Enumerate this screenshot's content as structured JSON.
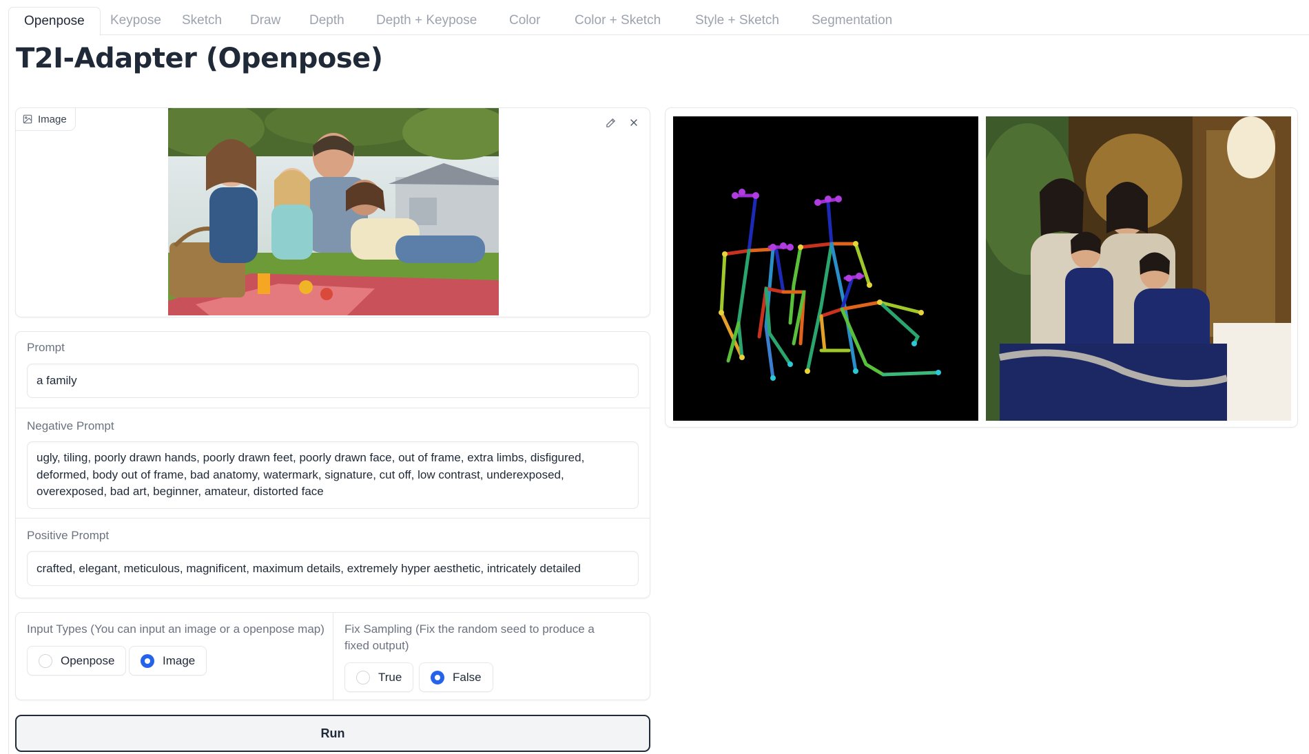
{
  "tabs": [
    {
      "label": "Openpose",
      "active": true
    },
    {
      "label": "Keypose"
    },
    {
      "label": "Sketch"
    },
    {
      "label": "Draw"
    },
    {
      "label": "Depth"
    },
    {
      "label": "Depth + Keypose"
    },
    {
      "label": "Color"
    },
    {
      "label": "Color + Sketch"
    },
    {
      "label": "Style + Sketch"
    },
    {
      "label": "Segmentation"
    }
  ],
  "title": "T2I-Adapter (Openpose)",
  "image_input": {
    "label": "Image",
    "icon": "image-icon",
    "tools": [
      "edit-icon",
      "close-icon"
    ]
  },
  "prompt": {
    "label": "Prompt",
    "value": "a family"
  },
  "negative_prompt": {
    "label": "Negative Prompt",
    "value": "ugly, tiling, poorly drawn hands, poorly drawn feet, poorly drawn face, out of frame, extra limbs, disfigured, deformed, body out of frame, bad anatomy, watermark, signature, cut off, low contrast, underexposed, overexposed, bad art, beginner, amateur, distorted face"
  },
  "positive_prompt": {
    "label": "Positive Prompt",
    "value": "crafted, elegant, meticulous, magnificent, maximum details, extremely hyper aesthetic, intricately detailed"
  },
  "input_types": {
    "label": "Input Types (You can input an image or a openpose map)",
    "options": [
      "Openpose",
      "Image"
    ],
    "selected": "Image"
  },
  "fix_sampling": {
    "label": "Fix Sampling (Fix the random seed to produce a fixed output)",
    "options": [
      "True",
      "False"
    ],
    "selected": "False"
  },
  "run_label": "Run",
  "colors": {
    "accent": "#2563eb",
    "border": "#e5e7eb",
    "muted_text": "#6b7280",
    "inactive_tab": "#9ca3af"
  }
}
